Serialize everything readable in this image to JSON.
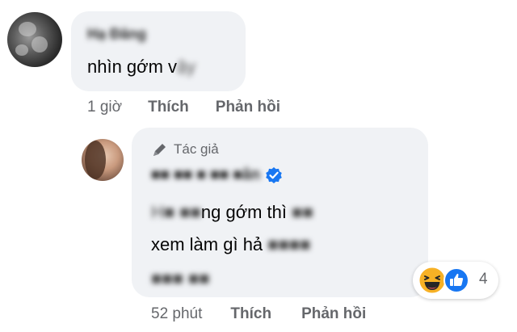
{
  "comment": {
    "author_name": "Hạ Đăng",
    "text_visible": "nhìn gớm v",
    "text_obscured": "ậy",
    "time": "1 giờ",
    "like_label": "Thích",
    "reply_label": "Phản hồi"
  },
  "reply": {
    "author_badge": "Tác giả",
    "author_name_obscured": "■■ ■■ ■ ■■ ■ân",
    "line1_obscured_start": "H■ ■■",
    "line1_visible": "ng gớm thì",
    "line1_obscured_end": "■■",
    "line2_visible": "xem làm gì hả",
    "line2_obscured": "■■■■",
    "line3_obscured": "■■■ ■■",
    "time": "52 phút",
    "like_label": "Thích",
    "reply_label": "Phản hồi"
  },
  "reactions": {
    "types": [
      "haha-icon",
      "like-icon"
    ],
    "count": "4"
  },
  "colors": {
    "bubble": "#f0f2f5",
    "secondary_text": "#65676b",
    "verified": "#1877f2",
    "like": "#1877f2",
    "haha": "#f7b125"
  }
}
